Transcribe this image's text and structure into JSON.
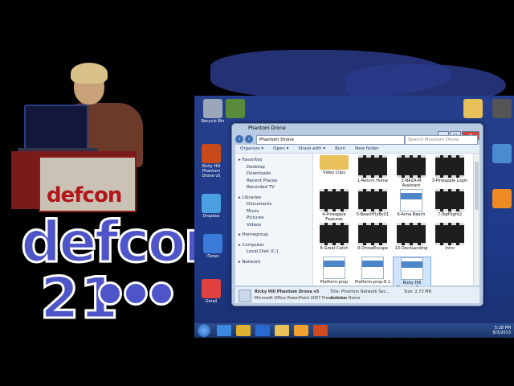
{
  "event": {
    "logo_word": "defcon",
    "logo_number": "21",
    "podium_text": "defcon"
  },
  "desktop": {
    "icons": [
      {
        "name": "recycle-bin-icon",
        "label": "Recycle Bin",
        "color": "#9aa7b8"
      },
      {
        "name": "app-icon-1",
        "label": "",
        "color": "#5b8a3a"
      },
      {
        "name": "app-icon-2",
        "label": "Ricky Hill Phantom Drone v5",
        "color": "#c84a1a"
      },
      {
        "name": "app-icon-3",
        "label": "Dropbox",
        "color": "#4aa0e0"
      },
      {
        "name": "app-icon-4",
        "label": "iTunes",
        "color": "#3a7ad8"
      },
      {
        "name": "app-icon-5",
        "label": "Gmail",
        "color": "#e04040"
      },
      {
        "name": "folder-icon",
        "label": "",
        "color": "#e8c15a"
      },
      {
        "name": "computer-icon",
        "label": "",
        "color": "#555"
      },
      {
        "name": "network-icon",
        "label": "",
        "color": "#4a8ad0"
      },
      {
        "name": "vlc-icon",
        "label": "",
        "color": "#f08a24"
      }
    ]
  },
  "window": {
    "title": "Phantom Drone",
    "address": "Phantom Drone",
    "search_placeholder": "Search Phantom Drone",
    "toolbar": [
      "Organize ▾",
      "Open ▾",
      "Share with ▾",
      "Burn",
      "New folder"
    ],
    "nav": [
      {
        "label": "Favorites",
        "type": "head"
      },
      {
        "label": "Desktop",
        "type": "sub"
      },
      {
        "label": "Downloads",
        "type": "sub"
      },
      {
        "label": "Recent Places",
        "type": "sub"
      },
      {
        "label": "Recorded TV",
        "type": "sub"
      },
      {
        "label": "Libraries",
        "type": "head"
      },
      {
        "label": "Documents",
        "type": "sub"
      },
      {
        "label": "Music",
        "type": "sub"
      },
      {
        "label": "Pictures",
        "type": "sub"
      },
      {
        "label": "Videos",
        "type": "sub"
      },
      {
        "label": "Homegroup",
        "type": "head"
      },
      {
        "label": "Computer",
        "type": "head"
      },
      {
        "label": "Local Disk (C:)",
        "type": "sub"
      },
      {
        "label": "Network",
        "type": "head"
      }
    ],
    "files": [
      {
        "label": "Video Clips",
        "kind": "folder"
      },
      {
        "label": "1-Return Home",
        "kind": "video"
      },
      {
        "label": "2-NAZA-M Assistant",
        "kind": "video"
      },
      {
        "label": "3-Pineapple Login",
        "kind": "video"
      },
      {
        "label": "4-Pineapple Features",
        "kind": "video"
      },
      {
        "label": "5-BeachFlyBy01",
        "kind": "video"
      },
      {
        "label": "6-Anna Beach",
        "kind": "doc"
      },
      {
        "label": "7-TopFlight2",
        "kind": "video"
      },
      {
        "label": "8-Great Catch",
        "kind": "video"
      },
      {
        "label": "9-DroneEscape",
        "kind": "video"
      },
      {
        "label": "10-DeckLanding",
        "kind": "video"
      },
      {
        "label": "Intro",
        "kind": "video"
      },
      {
        "label": "Platform-prop",
        "kind": "doc"
      },
      {
        "label": "Platform-prop-8 1",
        "kind": "doc"
      },
      {
        "label": "Ricky Hill Phantom Drone v5",
        "kind": "doc",
        "selected": true
      }
    ],
    "details": {
      "name": "Ricky Hill Phantom Drone v5",
      "type": "Microsoft Office PowerPoint 2007 Presentation",
      "title": "Title: Phantom Network Sec...",
      "size": "Size: 2.73 MB",
      "authors": "Authors: Home"
    }
  },
  "taskbar": {
    "time": "5:28 PM",
    "date": "8/3/2013",
    "items": [
      {
        "name": "ie-taskbar-icon",
        "color": "#3a8ae0"
      },
      {
        "name": "chrome-taskbar-icon",
        "color": "#e0b030"
      },
      {
        "name": "ie2-taskbar-icon",
        "color": "#2a6ad0"
      },
      {
        "name": "explorer-taskbar-icon",
        "color": "#e8c15a"
      },
      {
        "name": "media-taskbar-icon",
        "color": "#f0a030"
      },
      {
        "name": "powerpoint-taskbar-icon",
        "color": "#d04a20"
      }
    ]
  }
}
